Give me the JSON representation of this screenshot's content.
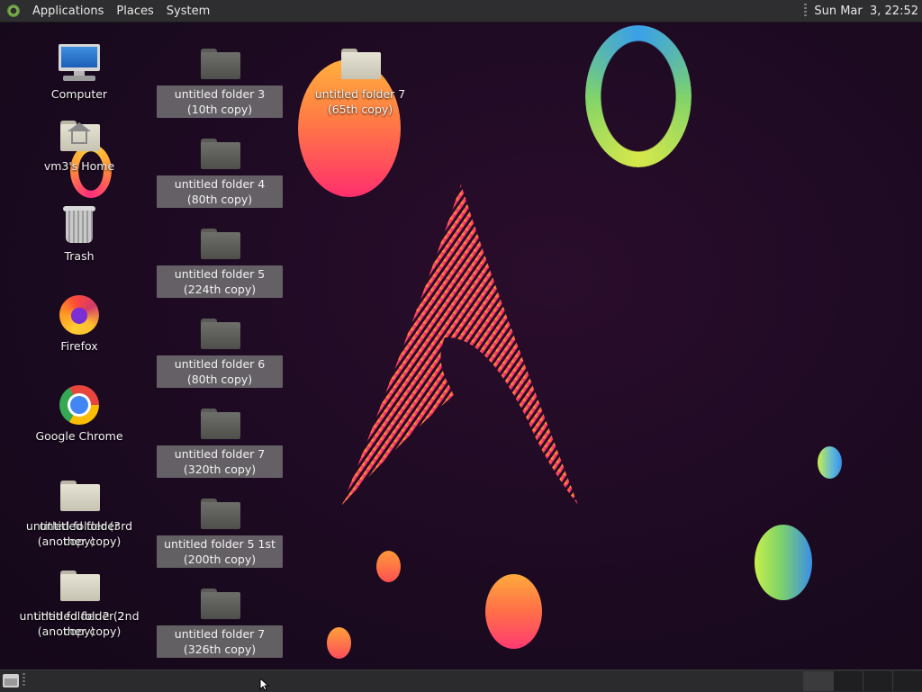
{
  "top_panel": {
    "menus": [
      "Applications",
      "Places",
      "System"
    ],
    "clock": "Sun Mar  3, 22:52",
    "icon": "distro-menu-icon"
  },
  "desktop": {
    "icons": [
      {
        "label": "Computer",
        "icon": "computer-icon"
      },
      {
        "label": "vm3's Home",
        "icon": "home-folder-icon"
      },
      {
        "label": "Trash",
        "icon": "trash-icon"
      },
      {
        "label": "Firefox",
        "icon": "firefox-icon"
      },
      {
        "label": "Google Chrome",
        "icon": "chrome-icon"
      },
      {
        "label": "untitled folder (3rd copy)",
        "icon": "folder-icon"
      },
      {
        "label": "untitled folder (another copy)",
        "icon": "folder-icon"
      },
      {
        "label": "untitled folder 2 (2nd copy)",
        "icon": "folder-icon"
      },
      {
        "label": "untitled folder 2 (another copy)",
        "icon": "folder-icon"
      },
      {
        "label": "untitled folder 3 (10th copy)",
        "icon": "folder-icon"
      },
      {
        "label": "untitled folder 4 (80th copy)",
        "icon": "folder-icon"
      },
      {
        "label": "untitled folder 5 (224th copy)",
        "icon": "folder-icon"
      },
      {
        "label": "untitled folder 6 (80th copy)",
        "icon": "folder-icon"
      },
      {
        "label": "untitled folder 7 (320th copy)",
        "icon": "folder-icon"
      },
      {
        "label": "untitled folder 5 1st (200th copy)",
        "icon": "folder-icon"
      },
      {
        "label": "untitled folder 7 (326th copy)",
        "icon": "folder-icon"
      },
      {
        "label": "untitled folder 7 (65th copy)",
        "icon": "folder-icon"
      }
    ]
  },
  "bottom_panel": {
    "show_desktop_icon": "show-desktop-icon",
    "workspaces": 4
  },
  "colors": {
    "panel": "#2e2e30",
    "background": "#1c0a21",
    "selection": "#787878"
  }
}
